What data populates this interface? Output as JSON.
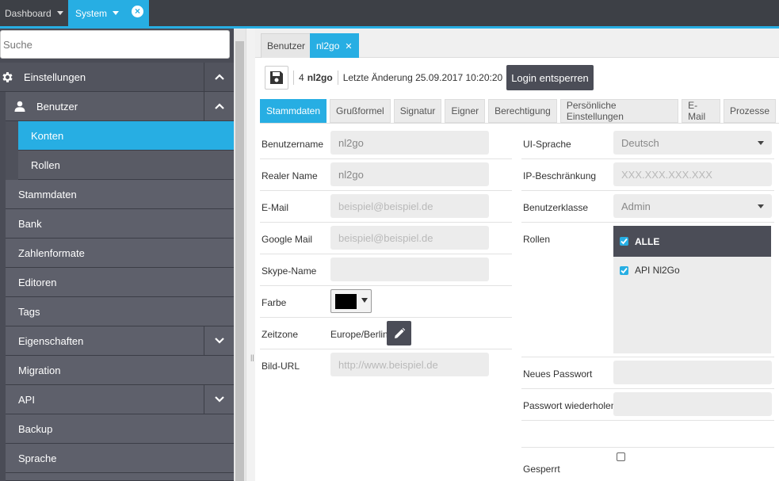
{
  "topbar": {
    "tabs": [
      {
        "label": "Dashboard"
      },
      {
        "label": "System"
      }
    ]
  },
  "sidebar": {
    "search_placeholder": "Suche",
    "items": [
      {
        "label": "Einstellungen",
        "icon": "gear-icon",
        "expanded": true
      },
      {
        "label": "Benutzer",
        "icon": "user-icon",
        "expanded": true
      },
      {
        "label": "Konten",
        "active": true
      },
      {
        "label": "Rollen"
      },
      {
        "label": "Stammdaten"
      },
      {
        "label": "Bank"
      },
      {
        "label": "Zahlenformate"
      },
      {
        "label": "Editoren"
      },
      {
        "label": "Tags"
      },
      {
        "label": "Eigenschaften",
        "expandable": true
      },
      {
        "label": "Migration"
      },
      {
        "label": "API",
        "expandable": true
      },
      {
        "label": "Backup"
      },
      {
        "label": "Sprache"
      }
    ]
  },
  "subtabs": [
    {
      "label": "Benutzer"
    },
    {
      "label": "nl2go",
      "active": true
    }
  ],
  "toolbar": {
    "id": "4",
    "name": "nl2go",
    "last_change": "Letzte Änderung 25.09.2017 10:20:20",
    "login_button": "Login entsperren"
  },
  "form_tabs": [
    {
      "label": "Stammdaten",
      "active": true
    },
    {
      "label": "Grußformel"
    },
    {
      "label": "Signatur"
    },
    {
      "label": "Eigner"
    },
    {
      "label": "Berechtigung"
    },
    {
      "label": "Persönliche Einstellungen"
    },
    {
      "label": "E-Mail"
    },
    {
      "label": "Prozesse"
    }
  ],
  "left_fields": {
    "username": {
      "label": "Benutzername",
      "value": "nl2go"
    },
    "realname": {
      "label": "Realer Name",
      "value": "nl2go"
    },
    "email": {
      "label": "E-Mail",
      "placeholder": "beispiel@beispiel.de"
    },
    "googlemail": {
      "label": "Google Mail",
      "placeholder": "beispiel@beispiel.de"
    },
    "skype": {
      "label": "Skype-Name",
      "value": ""
    },
    "color": {
      "label": "Farbe",
      "value_color": "#000000"
    },
    "timezone": {
      "label": "Zeitzone",
      "value": "Europe/Berlin"
    },
    "imageurl": {
      "label": "Bild-URL",
      "placeholder": "http://www.beispiel.de"
    }
  },
  "right_fields": {
    "ui_lang": {
      "label": "UI-Sprache",
      "value": "Deutsch"
    },
    "ip_restrict": {
      "label": "IP-Beschränkung",
      "placeholder": "XXX.XXX.XXX.XXX"
    },
    "user_class": {
      "label": "Benutzerklasse",
      "value": "Admin"
    },
    "roles": {
      "label": "Rollen",
      "all_label": "ALLE",
      "items": [
        {
          "label": "API Nl2Go",
          "checked": true
        }
      ]
    },
    "new_password": {
      "label": "Neues Passwort"
    },
    "repeat_password": {
      "label": "Passwort wiederholen"
    },
    "locked": {
      "label": "Gesperrt",
      "checked": false
    }
  },
  "colors": {
    "accent": "#27aee3",
    "dark": "#4b4d57"
  }
}
